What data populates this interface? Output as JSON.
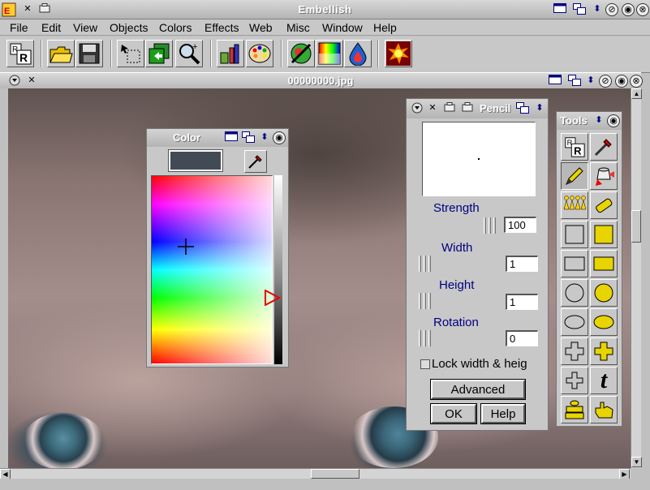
{
  "app": {
    "title": "Embellish",
    "controls": [
      "⊘",
      "◉"
    ]
  },
  "menubar": [
    "File",
    "Edit",
    "View",
    "Objects",
    "Colors",
    "Effects",
    "Web",
    "Misc",
    "Window",
    "Help"
  ],
  "toolbar": {
    "icons": [
      "rotate-resize-icon",
      "open-folder-icon",
      "save-disk-icon",
      "select-icon",
      "copy-layers-icon",
      "zoom-icon",
      "paint-tools-icon",
      "palette-icon",
      "no-color-icon",
      "color-grid-icon",
      "color-drop-icon",
      "explosion-effect-icon"
    ]
  },
  "image_window": {
    "title": "00000000.jpg"
  },
  "color_panel": {
    "title": "Color",
    "current_color": "#424b55"
  },
  "pencil_panel": {
    "title": "Pencil",
    "strength_label": "Strength",
    "strength_value": "100",
    "width_label": "Width",
    "width_value": "1",
    "height_label": "Height",
    "height_value": "1",
    "rotation_label": "Rotation",
    "rotation_value": "0",
    "lock_label": "Lock width & heig",
    "advanced_label": "Advanced",
    "ok_label": "OK",
    "help_label": "Help"
  },
  "tools_panel": {
    "title": "Tools",
    "text_tool_glyph": "t",
    "tools": [
      "transform-tool",
      "eyedropper-tool",
      "pencil-tool",
      "paint-bucket-tool",
      "people-stamp-tool",
      "airbrush-tool",
      "square-outline-tool",
      "square-filled-tool",
      "rect-outline-tool",
      "rect-filled-tool",
      "circle-outline-tool",
      "circle-filled-tool",
      "ellipse-outline-tool",
      "ellipse-filled-tool",
      "cross-outline-tool",
      "cross-filled-tool",
      "cross-small-tool",
      "text-tool",
      "brick-stamp-tool",
      "hand-pointer-tool"
    ]
  }
}
